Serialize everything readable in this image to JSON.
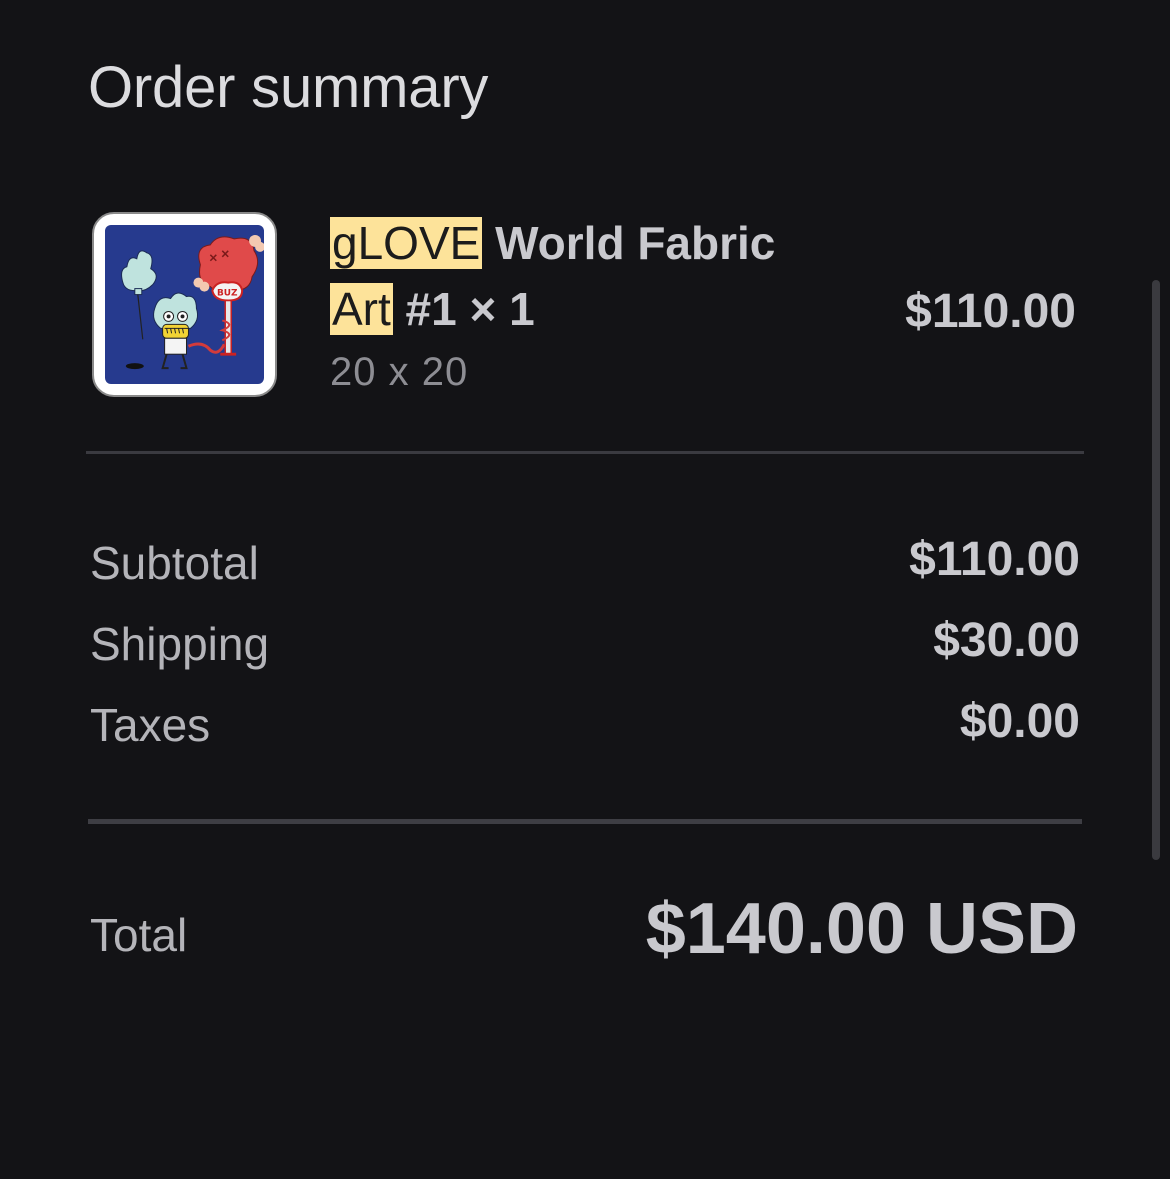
{
  "header": {
    "title": "Order summary"
  },
  "item": {
    "name_highlight_1": "gLOVE",
    "name_rest_1": " World Fabric",
    "name_highlight_2": "Art",
    "name_rest_2": " #1 × 1",
    "variant": "20 x 20",
    "price": "$110.00",
    "thumbnail_icon": "artwork-thumbnail",
    "thumbnail_text": "BUZ"
  },
  "summary": {
    "rows": [
      {
        "label": "Subtotal",
        "value": "$110.00"
      },
      {
        "label": "Shipping",
        "value": "$30.00"
      },
      {
        "label": "Taxes",
        "value": "$0.00"
      }
    ],
    "total_label": "Total",
    "total_value": "$140.00 USD"
  },
  "colors": {
    "background": "#131316",
    "highlight": "#fde39a",
    "text": "#c9c9ce"
  }
}
